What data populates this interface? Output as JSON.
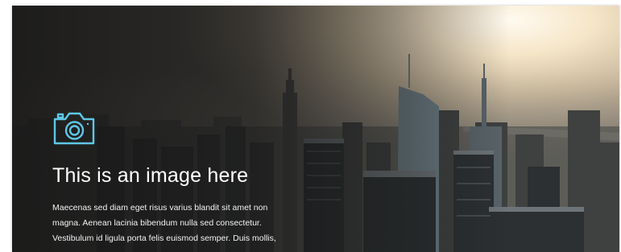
{
  "hero": {
    "icon": "camera-icon",
    "accent_color": "#5ec7e6",
    "title": "This is an image here",
    "body_lines": [
      "Maecenas sed diam eget risus varius blandit sit amet non",
      "magna. Aenean lacinia bibendum nulla sed consectetur.",
      "Vestibulum id ligula porta felis euismod semper. Duis mollis,"
    ]
  }
}
